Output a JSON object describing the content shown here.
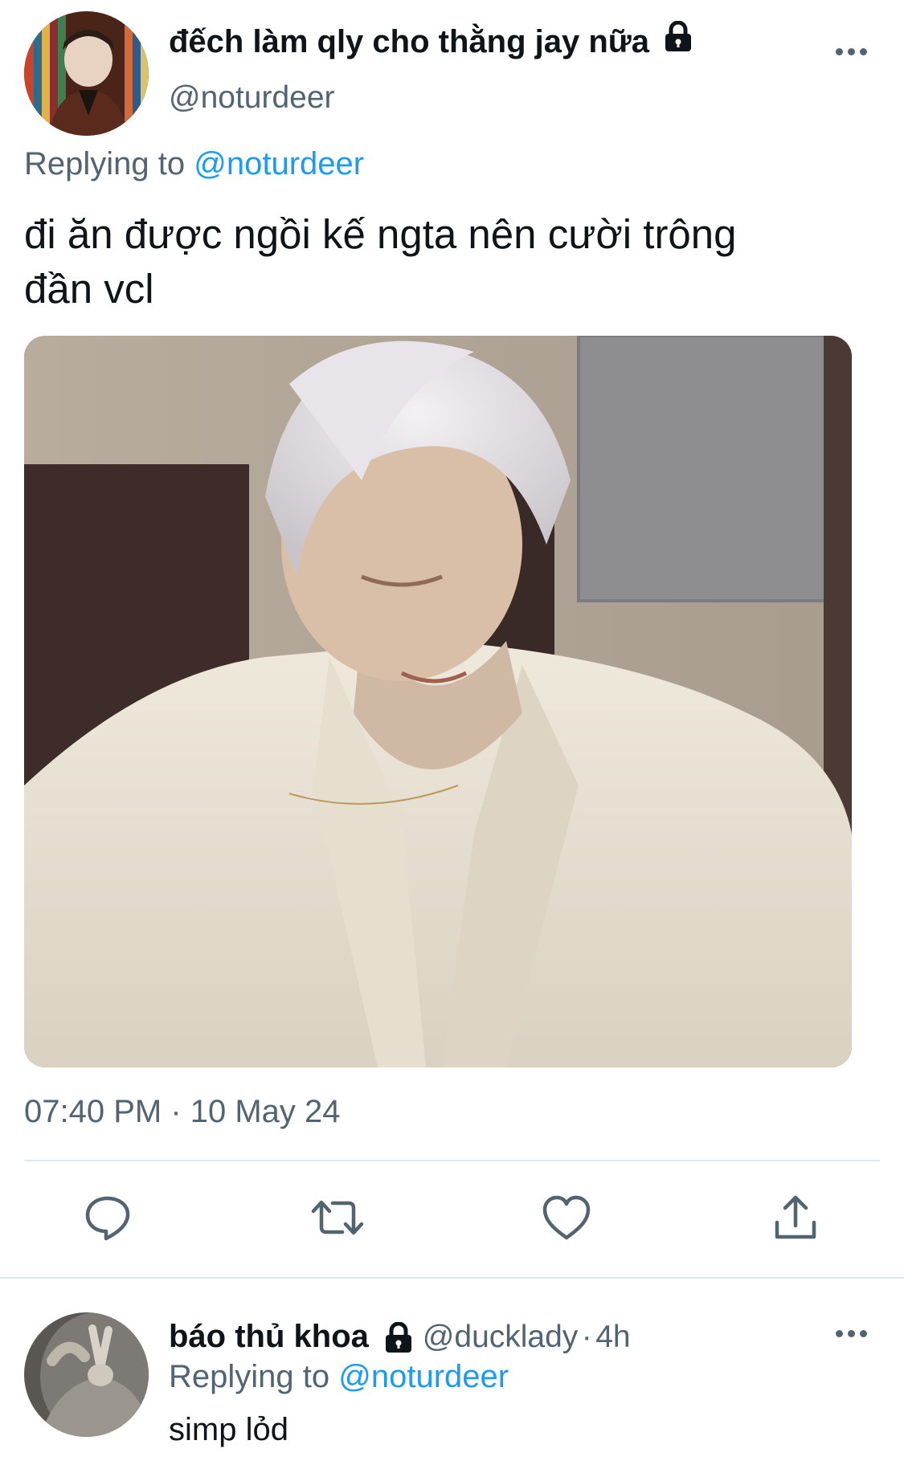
{
  "tweet": {
    "display_name": "đếch làm qly cho thằng jay nữa",
    "handle": "@noturdeer",
    "replying_prefix": "Replying to",
    "replying_handle": "@noturdeer",
    "text_line1": "đi ăn được ngồi kế ngta nên cười trông",
    "text_line2": "đần vcl",
    "timestamp": "07:40 PM · 10 May 24",
    "actions": [
      "reply-icon",
      "retweet-icon",
      "like-icon",
      "share-icon"
    ],
    "protected_icon": "lock-icon"
  },
  "reply": {
    "display_name": "báo thủ khoa",
    "handle": "@ducklady",
    "time_sep": "·",
    "time": "4h",
    "replying_prefix": "Replying to",
    "replying_handle": "@noturdeer",
    "text": "simp lỏd",
    "protected_icon": "lock-icon"
  },
  "colors": {
    "accent": "#1d9bf0",
    "secondary_text": "#536471",
    "divider": "#e1e8ed"
  }
}
